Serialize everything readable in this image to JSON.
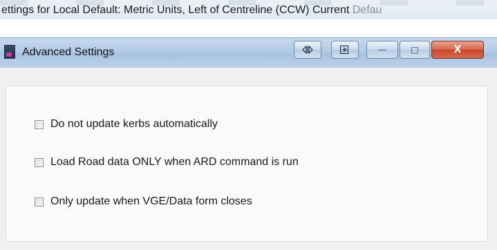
{
  "parent_window": {
    "title": "ettings for Local Default:  Metric Units, Left of Centreline (CCW) Current",
    "title_faded": " Defau"
  },
  "dialog": {
    "title": "Advanced Settings",
    "icon": "app-icon",
    "buttons": {
      "dock_icon": "dock-toggle-icon",
      "export_icon": "export-icon",
      "minimize_glyph": "—",
      "maximize_glyph": "□",
      "close_glyph": "X"
    }
  },
  "options": [
    {
      "label": "Do not update kerbs automatically",
      "checked": false
    },
    {
      "label": "Load Road data ONLY when ARD command is run",
      "checked": false
    },
    {
      "label": "Only update when VGE/Data form closes",
      "checked": false
    }
  ],
  "colors": {
    "titlebar": "#b3cbe6",
    "close_button": "#c8452b",
    "body": "#f0f0f0"
  }
}
